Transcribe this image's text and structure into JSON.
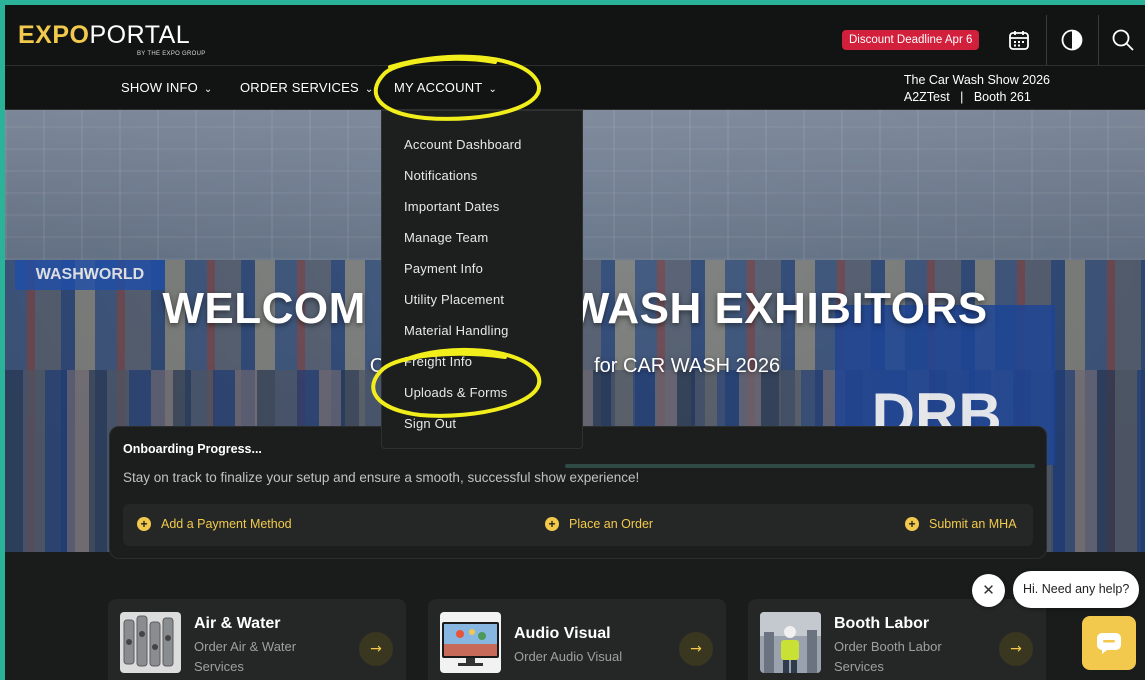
{
  "colors": {
    "accent": "#f2c94c",
    "deadline_bg": "#d21f3c",
    "teal_frame": "#2bb39a",
    "bg": "#1a1c1c"
  },
  "logo": {
    "word1": "EXPO",
    "word2": "PORTAL",
    "sub": "BY THE EXPO GROUP"
  },
  "header": {
    "deadline_badge": "Discount Deadline Apr 6",
    "icons": [
      "calendar-icon",
      "contrast-icon",
      "search-icon"
    ]
  },
  "nav": {
    "show_info": "SHOW INFO",
    "order_services": "ORDER SERVICES",
    "my_account": "MY ACCOUNT",
    "chevron": "⌄"
  },
  "show": {
    "name": "The Car Wash Show 2026",
    "company": "A2ZTest",
    "separator": "|",
    "booth": "Booth 261"
  },
  "hero": {
    "title_left": "WELCOM",
    "title_right": "WASH EXHIBITORS",
    "subtitle_left": "Or",
    "subtitle_right": "for CAR WASH 2026",
    "booth_labels": [
      "WASHWORLD",
      "DRB."
    ]
  },
  "account_menu": {
    "items": [
      "Account Dashboard",
      "Notifications",
      "Important Dates",
      "Manage Team",
      "Payment Info",
      "Utility Placement",
      "Material Handling",
      "Freight Info",
      "Uploads & Forms",
      "Sign Out"
    ]
  },
  "onboarding": {
    "title": "Onboarding Progress...",
    "description": "Stay on track to finalize your setup and ensure a smooth, successful show experience!",
    "actions": [
      "Add a Payment Method",
      "Place an Order",
      "Submit an MHA"
    ],
    "plus": "+"
  },
  "cards": [
    {
      "title": "Air & Water",
      "subtitle": "Order Air & Water Services",
      "icon": "pipes-thumbnail"
    },
    {
      "title": "Audio Visual",
      "subtitle": "Order Audio Visual",
      "icon": "screen-thumbnail"
    },
    {
      "title": "Booth Labor",
      "subtitle": "Order Booth Labor Services",
      "icon": "worker-thumbnail"
    }
  ],
  "card_arrow": "→",
  "chat": {
    "prompt": "Hi. Need any help?",
    "close": "✕"
  }
}
